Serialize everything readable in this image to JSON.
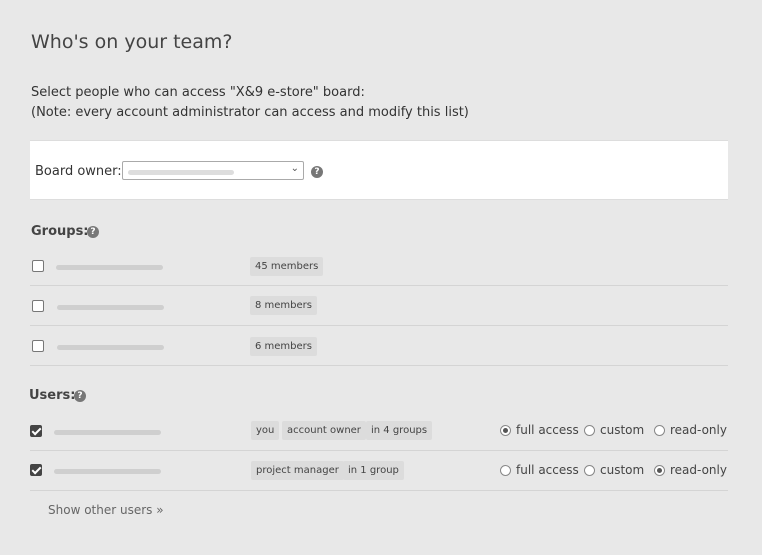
{
  "page": {
    "title": "Who's on your team?"
  },
  "description": {
    "line1": "Select people who can access \"X&9 e-store\" board:",
    "line2": "(Note: every account administrator can access and modify this list)"
  },
  "owner": {
    "label": "Board owner:",
    "select_value": ""
  },
  "help_glyph": "?",
  "groups": {
    "label": "Groups:",
    "items": [
      {
        "members": "45 members",
        "checked": false
      },
      {
        "members": "8 members",
        "checked": false
      },
      {
        "members": "6 members",
        "checked": false
      }
    ]
  },
  "users": {
    "label": "Users:",
    "items": [
      {
        "tags": [
          "you",
          "account owner",
          "in 4 groups"
        ],
        "checked": true,
        "access": "full access"
      },
      {
        "tags": [
          "project manager",
          "in 1 group"
        ],
        "checked": true,
        "access": "read-only"
      }
    ],
    "access_options": [
      "full access",
      "custom",
      "read-only"
    ]
  },
  "show_other_users": "Show other users »"
}
